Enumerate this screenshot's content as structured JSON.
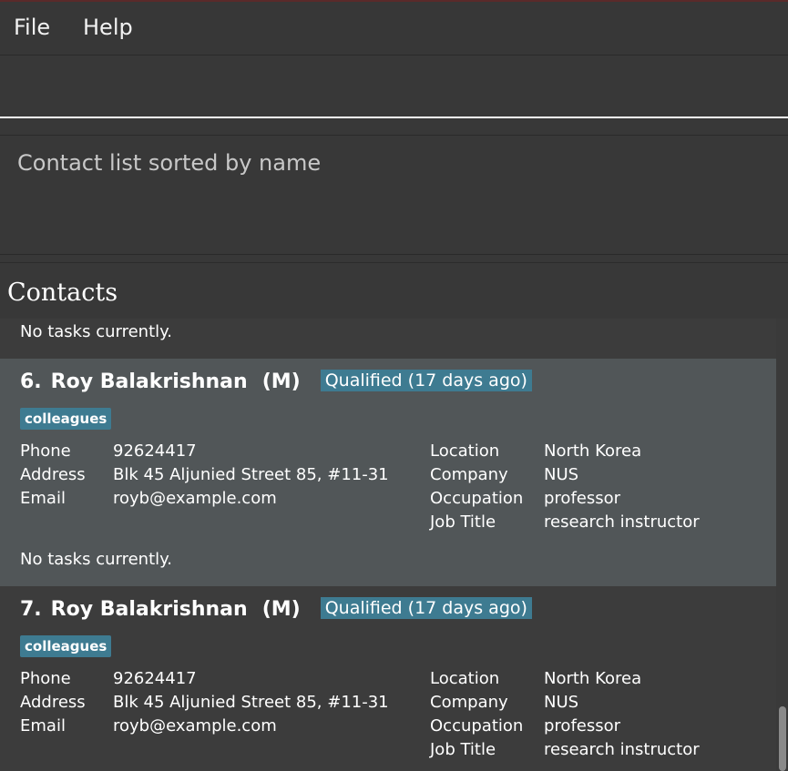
{
  "menu": {
    "file": "File",
    "help": "Help"
  },
  "command": {
    "value": ""
  },
  "result": {
    "message": "Contact list sorted by name"
  },
  "contacts_title": "Contacts",
  "partial_card": {
    "tasks": "No tasks currently."
  },
  "cards": [
    {
      "index": "6.",
      "name": "Roy Balakrishnan",
      "gender": "(M)",
      "status": "Qualified (17 days ago)",
      "tag": "colleagues",
      "phone_label": "Phone",
      "phone": "92624417",
      "address_label": "Address",
      "address": "Blk 45 Aljunied Street 85, #11-31",
      "email_label": "Email",
      "email": "royb@example.com",
      "location_label": "Location",
      "location": "North Korea",
      "company_label": "Company",
      "company": "NUS",
      "occupation_label": "Occupation",
      "occupation": "professor",
      "jobtitle_label": "Job Title",
      "jobtitle": "research instructor",
      "tasks": "No tasks currently."
    },
    {
      "index": "7.",
      "name": "Roy Balakrishnan",
      "gender": "(M)",
      "status": "Qualified (17 days ago)",
      "tag": "colleagues",
      "phone_label": "Phone",
      "phone": "92624417",
      "address_label": "Address",
      "address": "Blk 45 Aljunied Street 85, #11-31",
      "email_label": "Email",
      "email": "royb@example.com",
      "location_label": "Location",
      "location": "North Korea",
      "company_label": "Company",
      "company": "NUS",
      "occupation_label": "Occupation",
      "occupation": "professor",
      "jobtitle_label": "Job Title",
      "jobtitle": "research instructor"
    }
  ]
}
